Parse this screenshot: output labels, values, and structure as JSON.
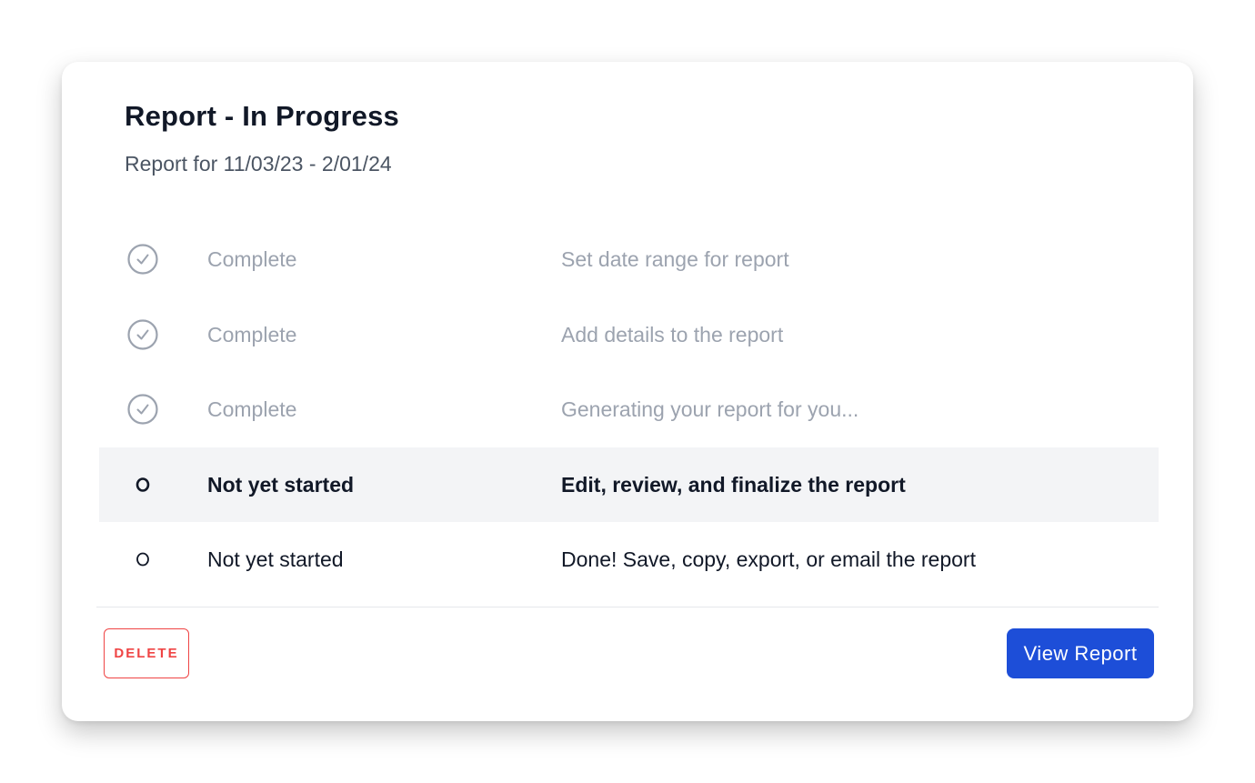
{
  "card": {
    "title": "Report - In Progress",
    "subtitle": "Report for 11/03/23 - 2/01/24"
  },
  "steps": [
    {
      "status": "Complete",
      "description": "Set date range for report",
      "state": "complete",
      "icon": "check-circle-icon"
    },
    {
      "status": "Complete",
      "description": "Add details to the report",
      "state": "complete",
      "icon": "check-circle-icon"
    },
    {
      "status": "Complete",
      "description": "Generating your report for you...",
      "state": "complete",
      "icon": "check-circle-icon"
    },
    {
      "status": "Not yet started",
      "description": "Edit, review, and finalize the report",
      "state": "current",
      "icon": "circle-icon"
    },
    {
      "status": "Not yet started",
      "description": "Done! Save, copy, export, or email the report",
      "state": "pending",
      "icon": "circle-icon"
    }
  ],
  "footer": {
    "delete_label": "DELETE",
    "view_label": "View Report"
  },
  "colors": {
    "accent": "#1d4ed8",
    "danger": "#ef4444",
    "muted_text": "#9ca3af",
    "active_row_bg": "#f3f4f6"
  }
}
